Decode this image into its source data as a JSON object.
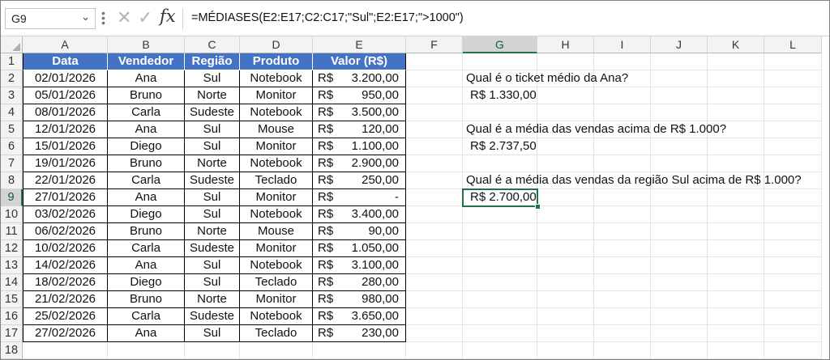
{
  "name_box": "G9",
  "formula": "=MÉDIASES(E2:E17;C2:C17;\"Sul\";E2:E17;\">1000\")",
  "icons": {
    "cancel": "close-icon",
    "enter": "check-icon",
    "function": "fx-icon",
    "dropdown": "chevron-down-icon"
  },
  "columns": [
    "A",
    "B",
    "C",
    "D",
    "E",
    "F",
    "G",
    "H",
    "I",
    "J",
    "K",
    "L"
  ],
  "rows": [
    "1",
    "2",
    "3",
    "4",
    "5",
    "6",
    "7",
    "8",
    "9",
    "10",
    "11",
    "12",
    "13",
    "14",
    "15",
    "16",
    "17",
    "18"
  ],
  "selected_cell": {
    "column": "G",
    "row": "9"
  },
  "table": {
    "headers": [
      "Data",
      "Vendedor",
      "Região",
      "Produto",
      "Valor (R$)"
    ],
    "header_color": "#4472C4",
    "currency": "R$",
    "rows": [
      {
        "date": "02/01/2026",
        "seller": "Ana",
        "region": "Sul",
        "product": "Notebook",
        "value": "3.200,00"
      },
      {
        "date": "05/01/2026",
        "seller": "Bruno",
        "region": "Norte",
        "product": "Monitor",
        "value": "950,00"
      },
      {
        "date": "08/01/2026",
        "seller": "Carla",
        "region": "Sudeste",
        "product": "Notebook",
        "value": "3.500,00"
      },
      {
        "date": "12/01/2026",
        "seller": "Ana",
        "region": "Sul",
        "product": "Mouse",
        "value": "120,00"
      },
      {
        "date": "15/01/2026",
        "seller": "Diego",
        "region": "Sul",
        "product": "Monitor",
        "value": "1.100,00"
      },
      {
        "date": "19/01/2026",
        "seller": "Bruno",
        "region": "Norte",
        "product": "Notebook",
        "value": "2.900,00"
      },
      {
        "date": "22/01/2026",
        "seller": "Carla",
        "region": "Sudeste",
        "product": "Teclado",
        "value": "250,00"
      },
      {
        "date": "27/01/2026",
        "seller": "Ana",
        "region": "Sul",
        "product": "Monitor",
        "value": "-"
      },
      {
        "date": "03/02/2026",
        "seller": "Diego",
        "region": "Sul",
        "product": "Notebook",
        "value": "3.400,00"
      },
      {
        "date": "06/02/2026",
        "seller": "Bruno",
        "region": "Norte",
        "product": "Mouse",
        "value": "90,00"
      },
      {
        "date": "10/02/2026",
        "seller": "Carla",
        "region": "Sudeste",
        "product": "Monitor",
        "value": "1.050,00"
      },
      {
        "date": "14/02/2026",
        "seller": "Ana",
        "region": "Sul",
        "product": "Notebook",
        "value": "3.100,00"
      },
      {
        "date": "18/02/2026",
        "seller": "Diego",
        "region": "Sul",
        "product": "Teclado",
        "value": "280,00"
      },
      {
        "date": "21/02/2026",
        "seller": "Bruno",
        "region": "Norte",
        "product": "Monitor",
        "value": "980,00"
      },
      {
        "date": "25/02/2026",
        "seller": "Carla",
        "region": "Sudeste",
        "product": "Notebook",
        "value": "3.650,00"
      },
      {
        "date": "27/02/2026",
        "seller": "Ana",
        "region": "Sul",
        "product": "Teclado",
        "value": "230,00"
      }
    ]
  },
  "questions": [
    {
      "question": "Qual é o ticket médio da Ana?",
      "question_row": "2",
      "answer": "R$ 1.330,00",
      "answer_row": "3"
    },
    {
      "question": "Qual é a média das vendas acima de R$ 1.000?",
      "question_row": "5",
      "answer": "R$ 2.737,50",
      "answer_row": "6"
    },
    {
      "question": "Qual é a média das vendas da região Sul acima de R$ 1.000?",
      "question_row": "8",
      "answer": "R$ 2.700,00",
      "answer_row": "9"
    }
  ]
}
